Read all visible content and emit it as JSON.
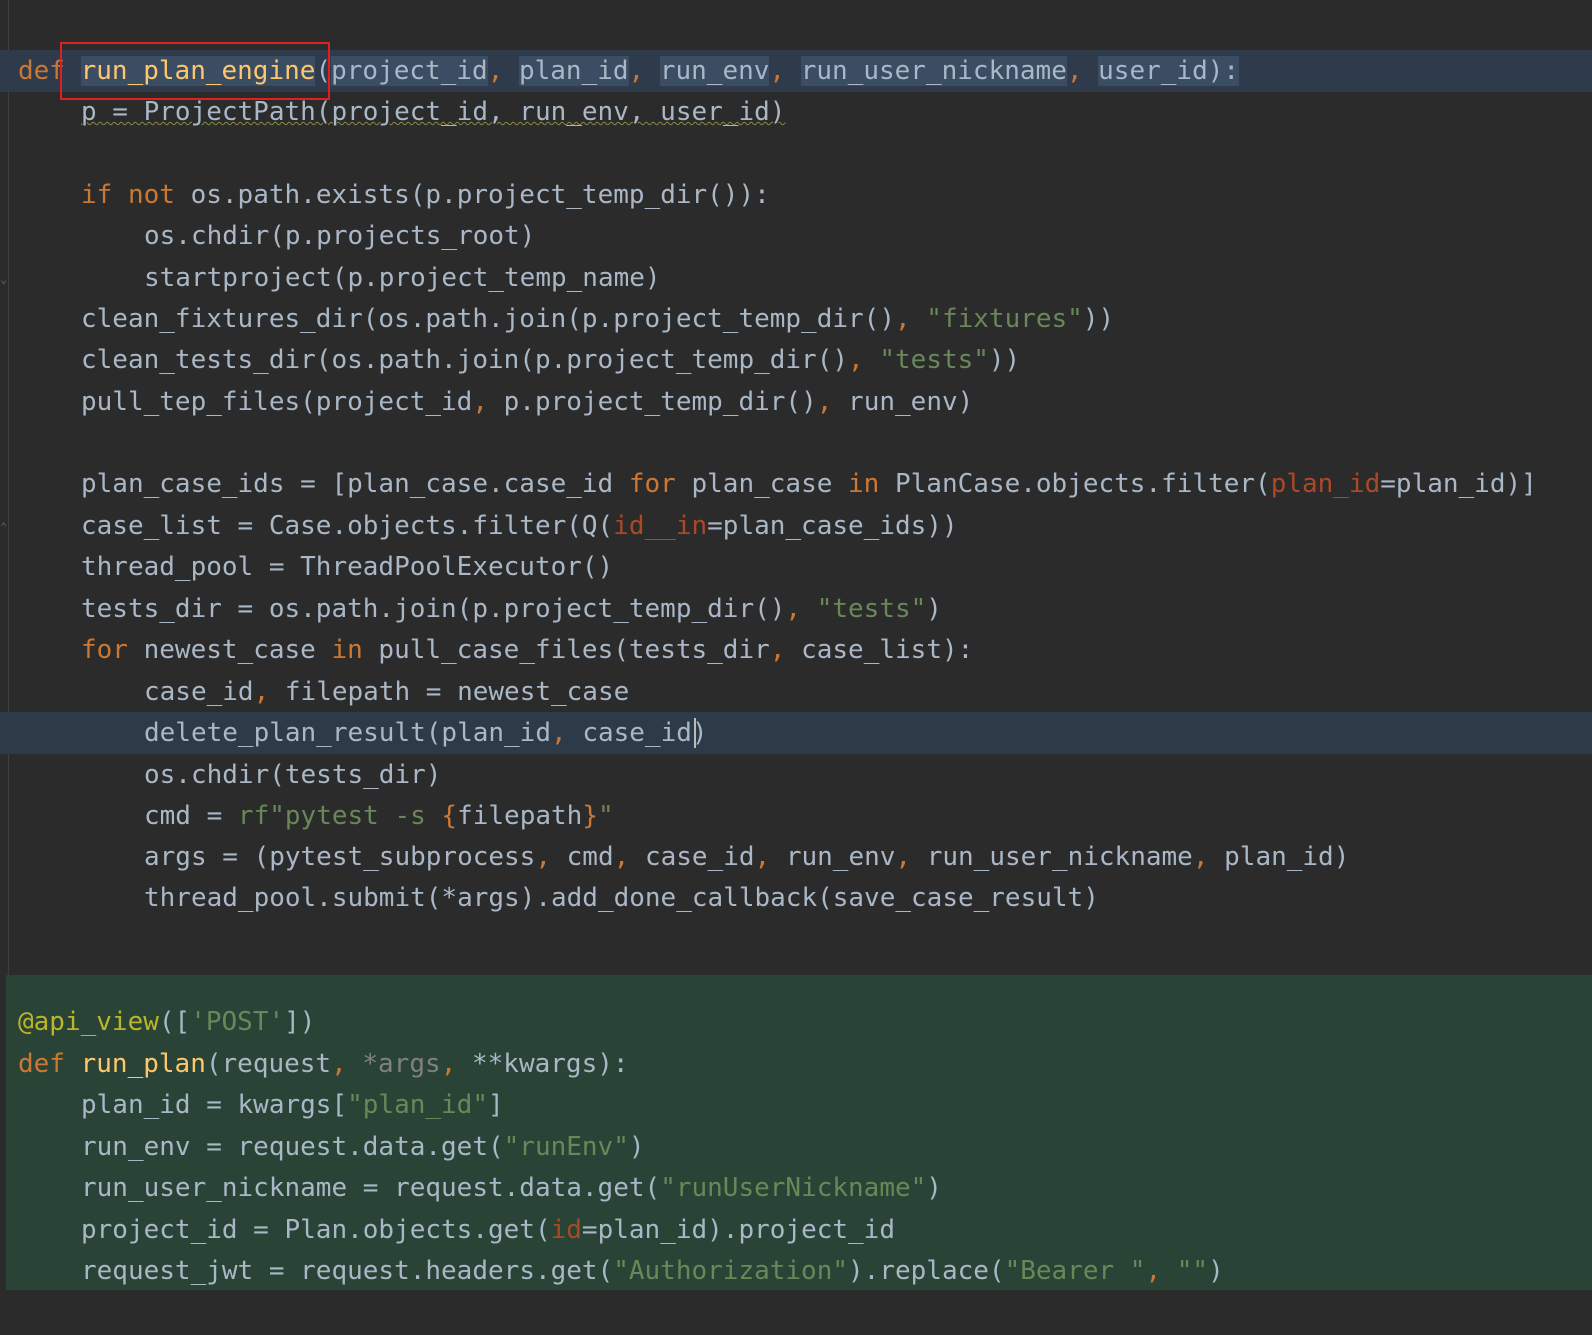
{
  "editor": {
    "highlight_box_label": "run_plan_engine",
    "lines": {
      "l1": {
        "def": "def",
        "name": "run_plan_engine",
        "paren": "(",
        "a1": "project_id",
        "c1": ", ",
        "a2": "plan_id",
        "c2": ", ",
        "a3": "run_env",
        "c3": ", ",
        "a4": "run_user_nickname",
        "c4": ", ",
        "a5": "user_id",
        "end": "):"
      },
      "l2": {
        "text": "p = ProjectPath(project_id, run_env, user_id)"
      },
      "l4": {
        "if": "if",
        "not": "not",
        "rest": " os.path.exists(p.project_temp_dir()):"
      },
      "l5": {
        "text": "os.chdir(p.projects_root)"
      },
      "l6": {
        "text": "startproject(p.project_temp_name)"
      },
      "l7": {
        "a": "clean_fixtures_dir(os.path.join(p.project_temp_dir()",
        "c": ", ",
        "s": "\"fixtures\"",
        "b": "))"
      },
      "l8": {
        "a": "clean_tests_dir(os.path.join(p.project_temp_dir()",
        "c": ", ",
        "s": "\"tests\"",
        "b": "))"
      },
      "l9": {
        "a": "pull_tep_files(project_id",
        "c1": ", ",
        "b": "p.project_temp_dir()",
        "c2": ", ",
        "d": "run_env)"
      },
      "l11": {
        "a": "plan_case_ids = [plan_case.case_id ",
        "for": "for",
        "b": " plan_case ",
        "in": "in",
        "c": " PlanCase.objects.filter(",
        "p": "plan_id",
        "d": "=plan_id)]"
      },
      "l12": {
        "a": "case_list = Case.objects.filter(Q(",
        "p": "id__in",
        "b": "=plan_case_ids))"
      },
      "l13": {
        "text": "thread_pool = ThreadPoolExecutor()"
      },
      "l14": {
        "a": "tests_dir = os.path.join(p.project_temp_dir()",
        "c": ", ",
        "s": "\"tests\"",
        "b": ")"
      },
      "l15": {
        "for": "for",
        "a": " newest_case ",
        "in": "in",
        "b": " pull_case_files(tests_dir",
        "c": ", ",
        "d": "case_list):"
      },
      "l16": {
        "a": "case_id",
        "c": ", ",
        "b": "filepath = newest_case"
      },
      "l17": {
        "a": "delete_plan_result(plan_id",
        "c": ", ",
        "b": "case_id)"
      },
      "l18": {
        "text": "os.chdir(tests_dir)"
      },
      "l19": {
        "a": "cmd = ",
        "s1": "rf\"pytest -s ",
        "o": "{",
        "b": "filepath",
        "cl": "}",
        "s2": "\""
      },
      "l20": {
        "a": "args = (pytest_subprocess",
        "c1": ", ",
        "b": "cmd",
        "c2": ", ",
        "d": "case_id",
        "c3": ", ",
        "e": "run_env",
        "c4": ", ",
        "f": "run_user_nickname",
        "c5": ", ",
        "g": "plan_id)"
      },
      "l21": {
        "text": "thread_pool.submit(*args).add_done_callback(save_case_result)"
      },
      "l24": {
        "dec": "@api_view",
        "a": "([",
        "s": "'POST'",
        "b": "])"
      },
      "l25": {
        "def": "def",
        "name": "run_plan",
        "a": "(request",
        "c1": ", ",
        "g": "*args",
        "c2": ", ",
        "b": "**kwargs):"
      },
      "l26": {
        "a": "plan_id = kwargs[",
        "s": "\"plan_id\"",
        "b": "]"
      },
      "l27": {
        "a": "run_env = request.data.get(",
        "s": "\"runEnv\"",
        "b": ")"
      },
      "l28": {
        "a": "run_user_nickname = request.data.get(",
        "s": "\"runUserNickname\"",
        "b": ")"
      },
      "l29": {
        "a": "project_id = Plan.objects.get(",
        "p": "id",
        "b": "=plan_id).project_id"
      },
      "l30": {
        "a": "request_jwt = request.headers.get(",
        "s": "\"Authorization\"",
        "b": ").replace(",
        "s2": "\"Bearer \"",
        "c": ", ",
        "s3": "\"\"",
        "d": ")"
      }
    }
  }
}
